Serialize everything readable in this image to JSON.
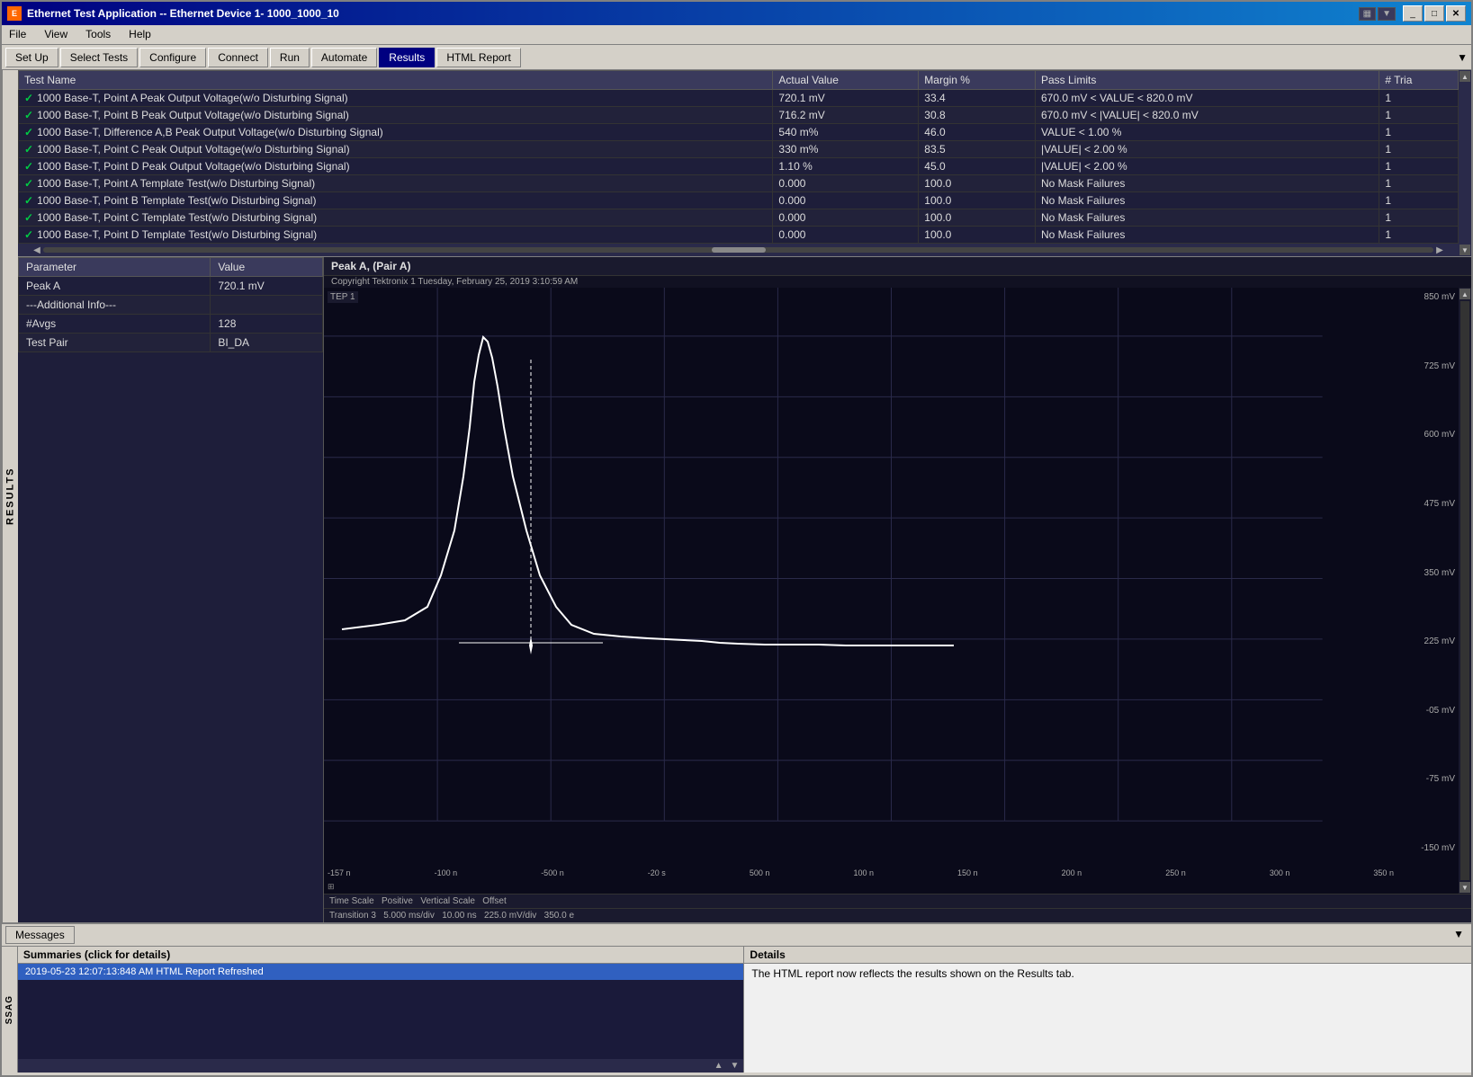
{
  "window": {
    "title": "Ethernet Test Application -- Ethernet Device 1- 1000_1000_10",
    "icon": "E"
  },
  "menu": {
    "items": [
      "File",
      "View",
      "Tools",
      "Help"
    ]
  },
  "toolbar": {
    "tabs": [
      "Set Up",
      "Select Tests",
      "Configure",
      "Connect",
      "Run",
      "Automate",
      "Results",
      "HTML Report"
    ]
  },
  "results_table": {
    "columns": [
      "Test Name",
      "Actual Value",
      "Margin %",
      "Pass Limits",
      "# Tria"
    ],
    "rows": [
      {
        "name": "1000 Base-T, Point A Peak Output Voltage(w/o Disturbing Signal)",
        "actual": "720.1 mV",
        "margin": "33.4",
        "limits": "670.0 mV < VALUE < 820.0 mV",
        "trials": "1",
        "pass": true
      },
      {
        "name": "1000 Base-T, Point B Peak Output Voltage(w/o Disturbing Signal)",
        "actual": "716.2 mV",
        "margin": "30.8",
        "limits": "670.0 mV < |VALUE| < 820.0 mV",
        "trials": "1",
        "pass": true
      },
      {
        "name": "1000 Base-T, Difference A,B Peak Output Voltage(w/o Disturbing Signal)",
        "actual": "540 m%",
        "margin": "46.0",
        "limits": "VALUE < 1.00 %",
        "trials": "1",
        "pass": true
      },
      {
        "name": "1000 Base-T, Point C Peak Output Voltage(w/o Disturbing Signal)",
        "actual": "330 m%",
        "margin": "83.5",
        "limits": "|VALUE| < 2.00 %",
        "trials": "1",
        "pass": true
      },
      {
        "name": "1000 Base-T, Point D Peak Output Voltage(w/o Disturbing Signal)",
        "actual": "1.10 %",
        "margin": "45.0",
        "limits": "|VALUE| < 2.00 %",
        "trials": "1",
        "pass": true
      },
      {
        "name": "1000 Base-T, Point A Template Test(w/o Disturbing Signal)",
        "actual": "0.000",
        "margin": "100.0",
        "limits": "No Mask Failures",
        "trials": "1",
        "pass": true
      },
      {
        "name": "1000 Base-T, Point B Template Test(w/o Disturbing Signal)",
        "actual": "0.000",
        "margin": "100.0",
        "limits": "No Mask Failures",
        "trials": "1",
        "pass": true
      },
      {
        "name": "1000 Base-T, Point C Template Test(w/o Disturbing Signal)",
        "actual": "0.000",
        "margin": "100.0",
        "limits": "No Mask Failures",
        "trials": "1",
        "pass": true
      },
      {
        "name": "1000 Base-T, Point D Template Test(w/o Disturbing Signal)",
        "actual": "0.000",
        "margin": "100.0",
        "limits": "No Mask Failures",
        "trials": "1",
        "pass": true
      }
    ]
  },
  "param_table": {
    "columns": [
      "Parameter",
      "Value"
    ],
    "rows": [
      {
        "param": "Peak A",
        "value": "720.1 mV"
      },
      {
        "param": "---Additional Info---",
        "value": ""
      },
      {
        "param": "#Avgs",
        "value": "128"
      },
      {
        "param": "Test Pair",
        "value": "BI_DA"
      }
    ]
  },
  "chart": {
    "title": "Peak A, (Pair A)",
    "subtitle": "Copyright Tektronix 1 Tuesday, February 25, 2019 3:10:59 AM",
    "label": "TEP 1",
    "y_axis": [
      "850 mV",
      "725 mV",
      "600 mV",
      "475 mV",
      "350 mV",
      "225 mV",
      "-05 mV",
      "-75 mV",
      "-150 mV"
    ],
    "x_axis": [
      "-157 n",
      "-100 n",
      "-500 n",
      "-20 s",
      "500 n",
      "100 n",
      "150 n",
      "200 n",
      "250 n",
      "300 n",
      "350 n"
    ],
    "info_bar": {
      "label1": "Time Scale  Positive  Vertical Scale  Offset",
      "label2": "Transition 3  5.000 ms/div 10.00 ns  225.0 mV/div  350.0 e"
    }
  },
  "messages": {
    "tab_label": "Messages",
    "summaries_label": "Summaries (click for details)",
    "details_label": "Details",
    "items": [
      "2019-05-23 12:07:13:848 AM HTML Report Refreshed"
    ],
    "details_text": "The HTML report now reflects the results shown on the Results tab."
  },
  "side_label": "RESULTS",
  "ssag_label": "SSAG"
}
